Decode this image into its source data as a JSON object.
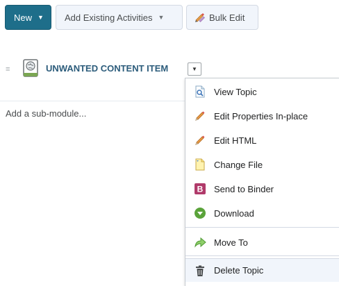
{
  "toolbar": {
    "new_label": "New",
    "new_caret": "▼",
    "add_existing_label": "Add Existing Activities",
    "add_existing_caret": "▼",
    "bulk_edit_label": "Bulk Edit"
  },
  "module": {
    "drag_glyph": "≡",
    "title": "UNWANTED CONTENT ITEM",
    "toggle_glyph": "▼",
    "sub_module_placeholder": "Add a sub-module..."
  },
  "menu": {
    "items": [
      {
        "label": "View Topic",
        "icon": "view-topic-icon"
      },
      {
        "label": "Edit Properties In-place",
        "icon": "pencil-icon"
      },
      {
        "label": "Edit HTML",
        "icon": "pencil-icon"
      },
      {
        "label": "Change File",
        "icon": "file-icon"
      },
      {
        "label": "Send to Binder",
        "icon": "binder-icon"
      },
      {
        "label": "Download",
        "icon": "download-icon"
      },
      {
        "label": "Move To",
        "icon": "move-arrow-icon"
      },
      {
        "label": "Delete Topic",
        "icon": "trash-icon"
      }
    ],
    "binder_letter": "B"
  },
  "colors": {
    "primary_button": "#1e6e8a",
    "module_title": "#2c5c7b",
    "binder": "#b03a6a",
    "download": "#5aa33a"
  }
}
